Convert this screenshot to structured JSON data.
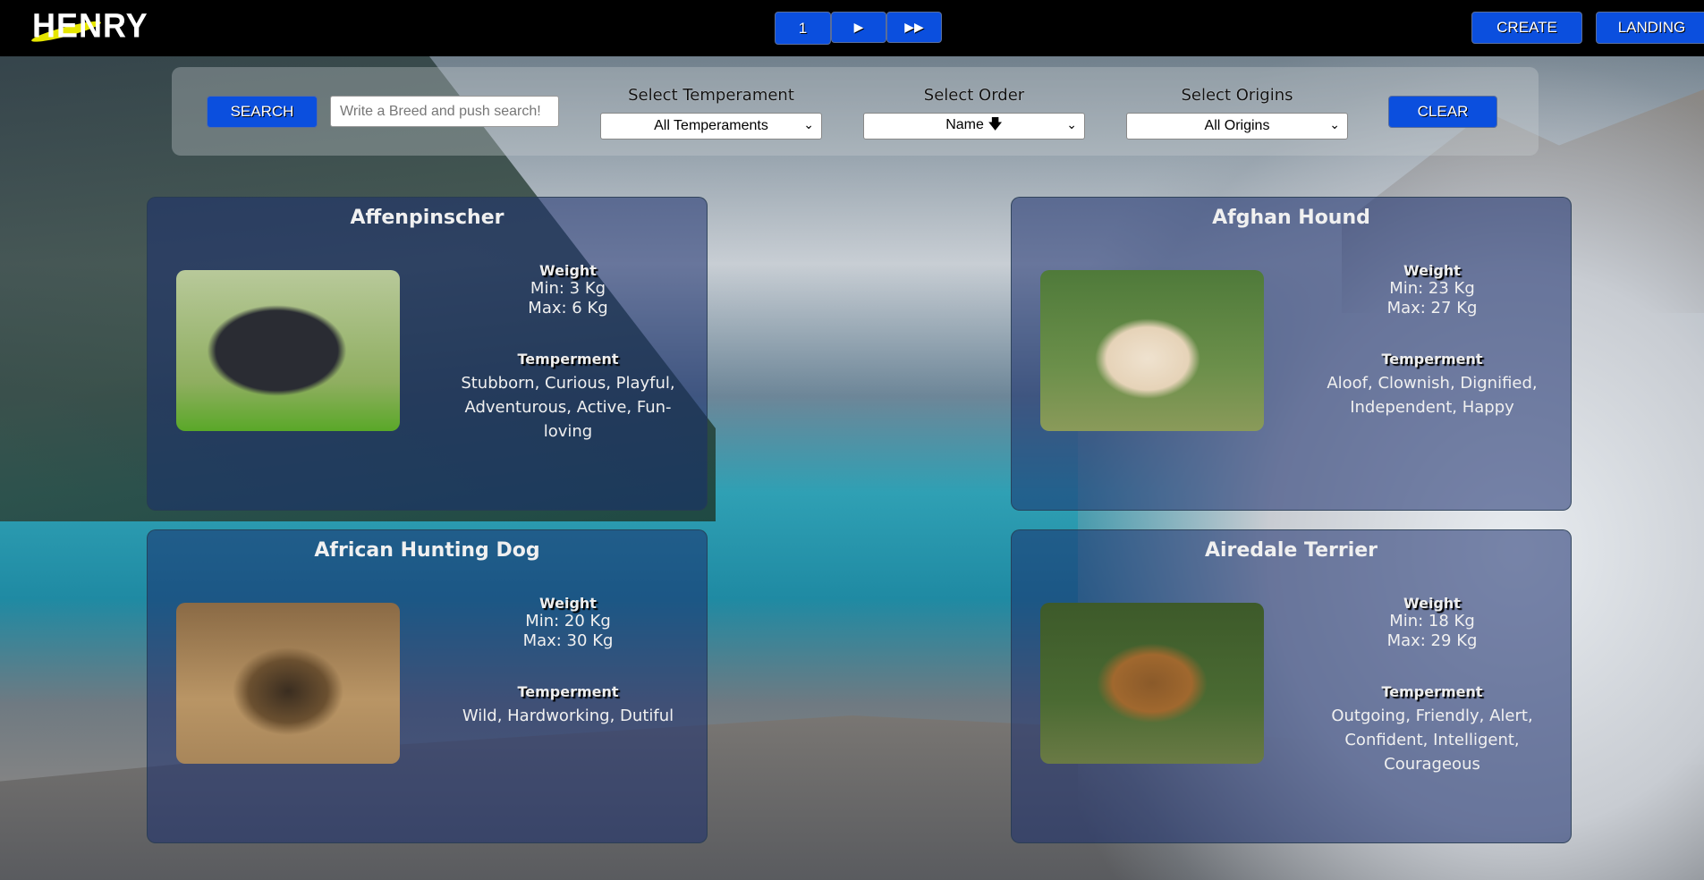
{
  "header": {
    "logo": "HENRY",
    "pagination": {
      "current": "1",
      "next": "▶",
      "last": "▶▶"
    },
    "create": "CREATE",
    "landing": "LANDING"
  },
  "filters": {
    "search_label": "SEARCH",
    "search_placeholder": "Write a Breed and push search!",
    "temperament": {
      "label": "Select Temperament",
      "value": "All Temperaments"
    },
    "order": {
      "label": "Select Order",
      "value": "Name 🡇"
    },
    "origins": {
      "label": "Select Origins",
      "value": "All Origins"
    },
    "clear": "CLEAR"
  },
  "labels": {
    "weight": "Weight",
    "temperament": "Temperment"
  },
  "cards": [
    {
      "name": "Affenpinscher",
      "min": "Min: 3 Kg",
      "max": "Max: 6 Kg",
      "temperament": "Stubborn, Curious, Playful, Adventurous, Active, Fun-loving"
    },
    {
      "name": "Afghan Hound",
      "min": "Min: 23 Kg",
      "max": "Max: 27 Kg",
      "temperament": "Aloof, Clownish, Dignified, Independent, Happy"
    },
    {
      "name": "African Hunting Dog",
      "min": "Min: 20 Kg",
      "max": "Max: 30 Kg",
      "temperament": "Wild, Hardworking, Dutiful"
    },
    {
      "name": "Airedale Terrier",
      "min": "Min: 18 Kg",
      "max": "Max: 29 Kg",
      "temperament": "Outgoing, Friendly, Alert, Confident, Intelligent, Courageous"
    }
  ]
}
